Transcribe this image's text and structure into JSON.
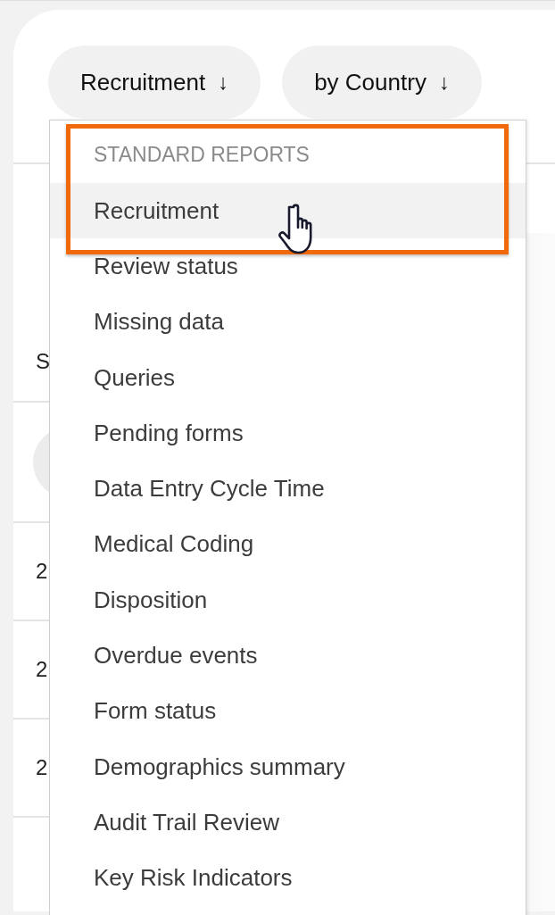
{
  "toolbar": {
    "buttons": [
      {
        "label": "Recruitment",
        "icon": "↓"
      },
      {
        "label": "by Country",
        "icon": "↓"
      }
    ]
  },
  "table": {
    "header": {
      "column_1": "S"
    },
    "rows": [
      {
        "column_1": "2"
      },
      {
        "column_1": "2"
      },
      {
        "column_1": "2"
      }
    ]
  },
  "menu": {
    "section": "STANDARD REPORTS",
    "items": [
      {
        "label": "Recruitment",
        "selected": true
      },
      {
        "label": "Review status",
        "selected": false
      },
      {
        "label": "Missing data",
        "selected": false
      },
      {
        "label": "Queries",
        "selected": false
      },
      {
        "label": "Pending forms",
        "selected": false
      },
      {
        "label": "Data Entry Cycle Time",
        "selected": false
      },
      {
        "label": "Medical Coding",
        "selected": false
      },
      {
        "label": "Disposition",
        "selected": false
      },
      {
        "label": "Overdue events",
        "selected": false
      },
      {
        "label": "Form status",
        "selected": false
      },
      {
        "label": "Demographics summary",
        "selected": false
      },
      {
        "label": "Audit Trail Review",
        "selected": false
      },
      {
        "label": "Key Risk Indicators",
        "selected": false
      }
    ]
  }
}
